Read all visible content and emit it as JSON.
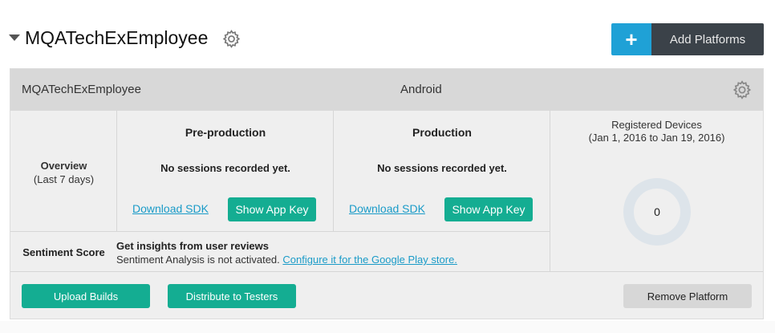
{
  "header": {
    "app_title": "MQATechExEmployee",
    "add_platforms": {
      "icon": "+",
      "label": "Add Platforms"
    }
  },
  "platform_card": {
    "name": "MQATechExEmployee",
    "os": "Android",
    "overview": {
      "title": "Overview",
      "subtitle": "(Last 7 days)"
    },
    "environments": [
      {
        "title": "Pre-production",
        "message": "No sessions recorded yet.",
        "download_link": "Download SDK",
        "app_key_button": "Show App Key"
      },
      {
        "title": "Production",
        "message": "No sessions recorded yet.",
        "download_link": "Download SDK",
        "app_key_button": "Show App Key"
      }
    ],
    "devices": {
      "title": "Registered Devices",
      "range": "(Jan 1, 2016 to Jan 19, 2016)",
      "count": "0"
    },
    "sentiment": {
      "label": "Sentiment Score",
      "heading": "Get insights from user reviews",
      "text": "Sentiment Analysis is not activated.",
      "link": "Configure it for the Google Play store."
    },
    "footer": {
      "upload_label": "Upload Builds",
      "distribute_label": "Distribute to Testers",
      "remove_label": "Remove Platform"
    }
  },
  "colors": {
    "accent_green": "#14ad92",
    "accent_blue": "#1fa1d6",
    "dark_button": "#3b4249",
    "link": "#1a9bc8"
  },
  "icons": [
    "caret-down-icon",
    "gear-icon",
    "plus-icon",
    "donut-chart"
  ]
}
